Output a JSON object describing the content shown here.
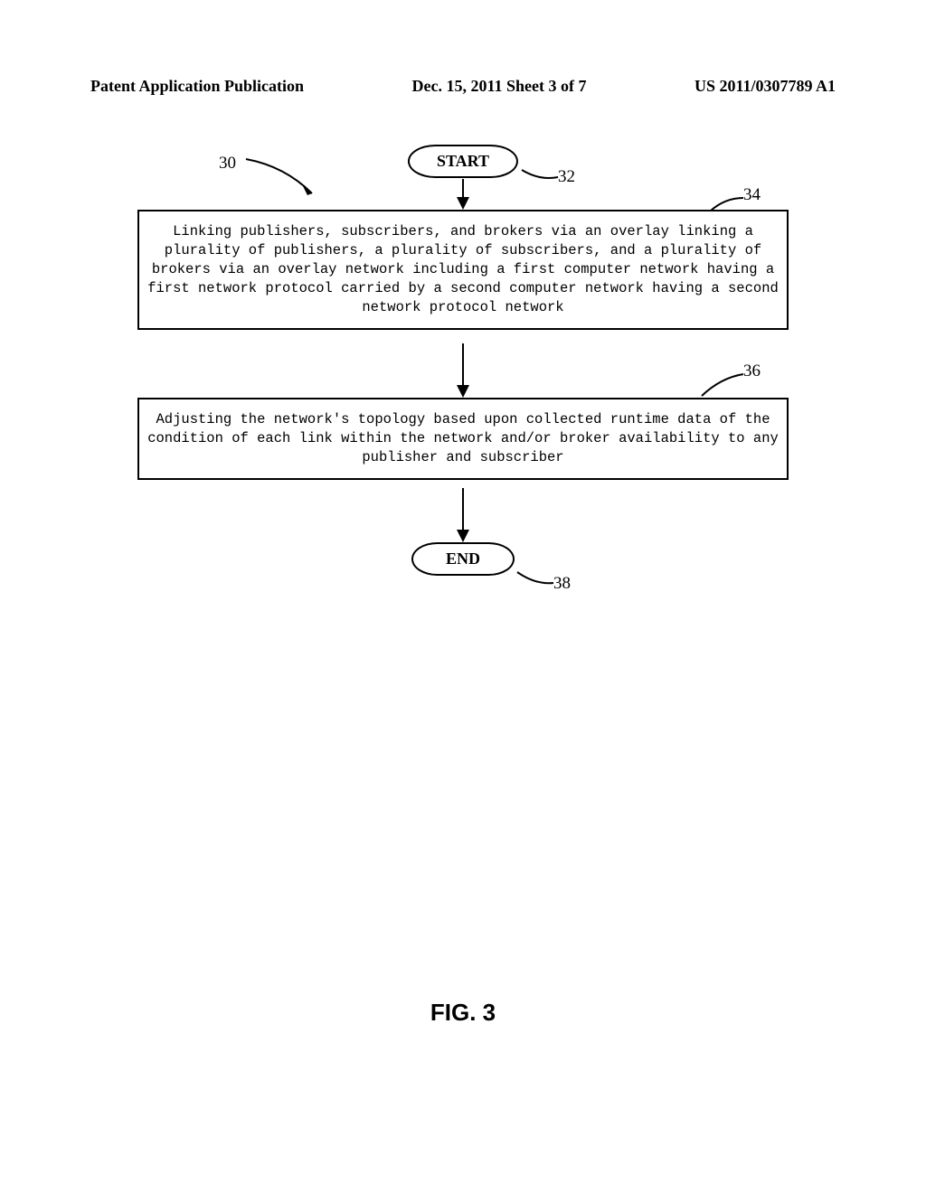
{
  "header": {
    "left": "Patent Application Publication",
    "center": "Dec. 15, 2011  Sheet 3 of 7",
    "right": "US 2011/0307789 A1"
  },
  "refs": {
    "r30": "30",
    "r32": "32",
    "r34": "34",
    "r36": "36",
    "r38": "38"
  },
  "terminals": {
    "start": "START",
    "end": "END"
  },
  "boxes": {
    "box1": "Linking publishers, subscribers, and brokers via an overlay linking a plurality of publishers, a plurality of subscribers, and a plurality of brokers via an overlay network including a first computer network having a first network protocol carried by a second computer network having a second network protocol network",
    "box2": "Adjusting the network's topology based upon collected runtime data of the condition of each link within the network and/or broker availability to any publisher and subscriber"
  },
  "figure": "FIG. 3"
}
